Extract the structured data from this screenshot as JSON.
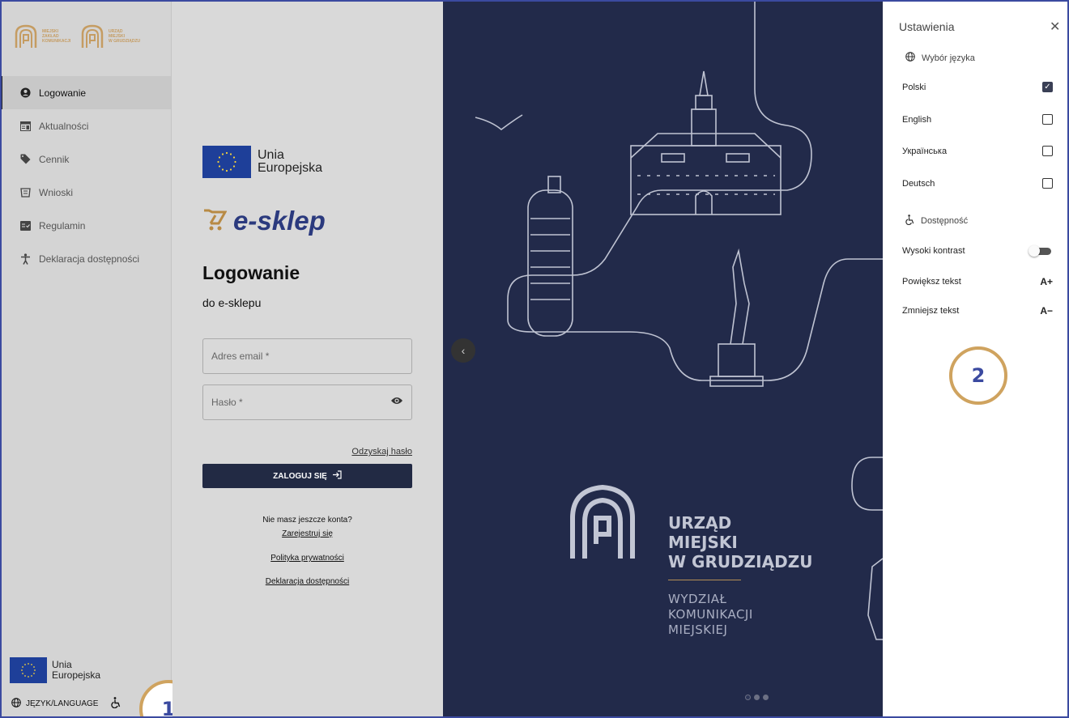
{
  "sidebar": {
    "logo1": {
      "line1": "MIEJSKI",
      "line2": "ZAKŁAD",
      "line3": "KOMUNIKACJI"
    },
    "logo2": {
      "line1": "URZĄD",
      "line2": "MIEJSKI",
      "line3": "W GRUDZIĄDZU"
    },
    "items": [
      {
        "label": "Logowanie",
        "icon": "account-circle-icon"
      },
      {
        "label": "Aktualności",
        "icon": "news-icon"
      },
      {
        "label": "Cennik",
        "icon": "tag-icon"
      },
      {
        "label": "Wnioski",
        "icon": "forms-icon"
      },
      {
        "label": "Regulamin",
        "icon": "rules-icon"
      },
      {
        "label": "Deklaracja dostępności",
        "icon": "accessibility-icon"
      }
    ],
    "eu_line1": "Unia",
    "eu_line2": "Europejska",
    "language_label": "JĘZYK/LANGUAGE",
    "badge": "1"
  },
  "main": {
    "eu_line1": "Unia",
    "eu_line2": "Europejska",
    "brand": "e-sklep",
    "title": "Logowanie",
    "subtitle": "do e-sklepu",
    "email_placeholder": "Adres email *",
    "password_placeholder": "Hasło *",
    "recover": "Odzyskaj hasło",
    "login_button": "ZALOGUJ SIĘ",
    "no_account": "Nie masz jeszcze konta?",
    "register": "Zarejestruj się",
    "privacy": "Polityka prywatności",
    "accessibility_decl": "Deklaracja dostępności"
  },
  "hero": {
    "um_line1": "URZĄD",
    "um_line2": "MIEJSKI",
    "um_line3": "W GRUDZIĄDZU",
    "wk_line1": "WYDZIAŁ",
    "wk_line2": "KOMUNIKACJI",
    "wk_line3": "MIEJSKIEJ"
  },
  "settings": {
    "title": "Ustawienia",
    "language_section": "Wybór języka",
    "languages": [
      {
        "label": "Polski",
        "checked": true
      },
      {
        "label": "English",
        "checked": false
      },
      {
        "label": "Українська",
        "checked": false
      },
      {
        "label": "Deutsch",
        "checked": false
      }
    ],
    "access_section": "Dostępność",
    "high_contrast": "Wysoki kontrast",
    "enlarge": "Powiększ tekst",
    "enlarge_symbol": "A+",
    "shrink": "Zmniejsz tekst",
    "shrink_symbol": "A−",
    "badge": "2"
  },
  "colors": {
    "accent": "#222a44",
    "hero_bg": "#222a4a",
    "gold": "#cfa35f",
    "badge_text": "#3b4aa0"
  }
}
